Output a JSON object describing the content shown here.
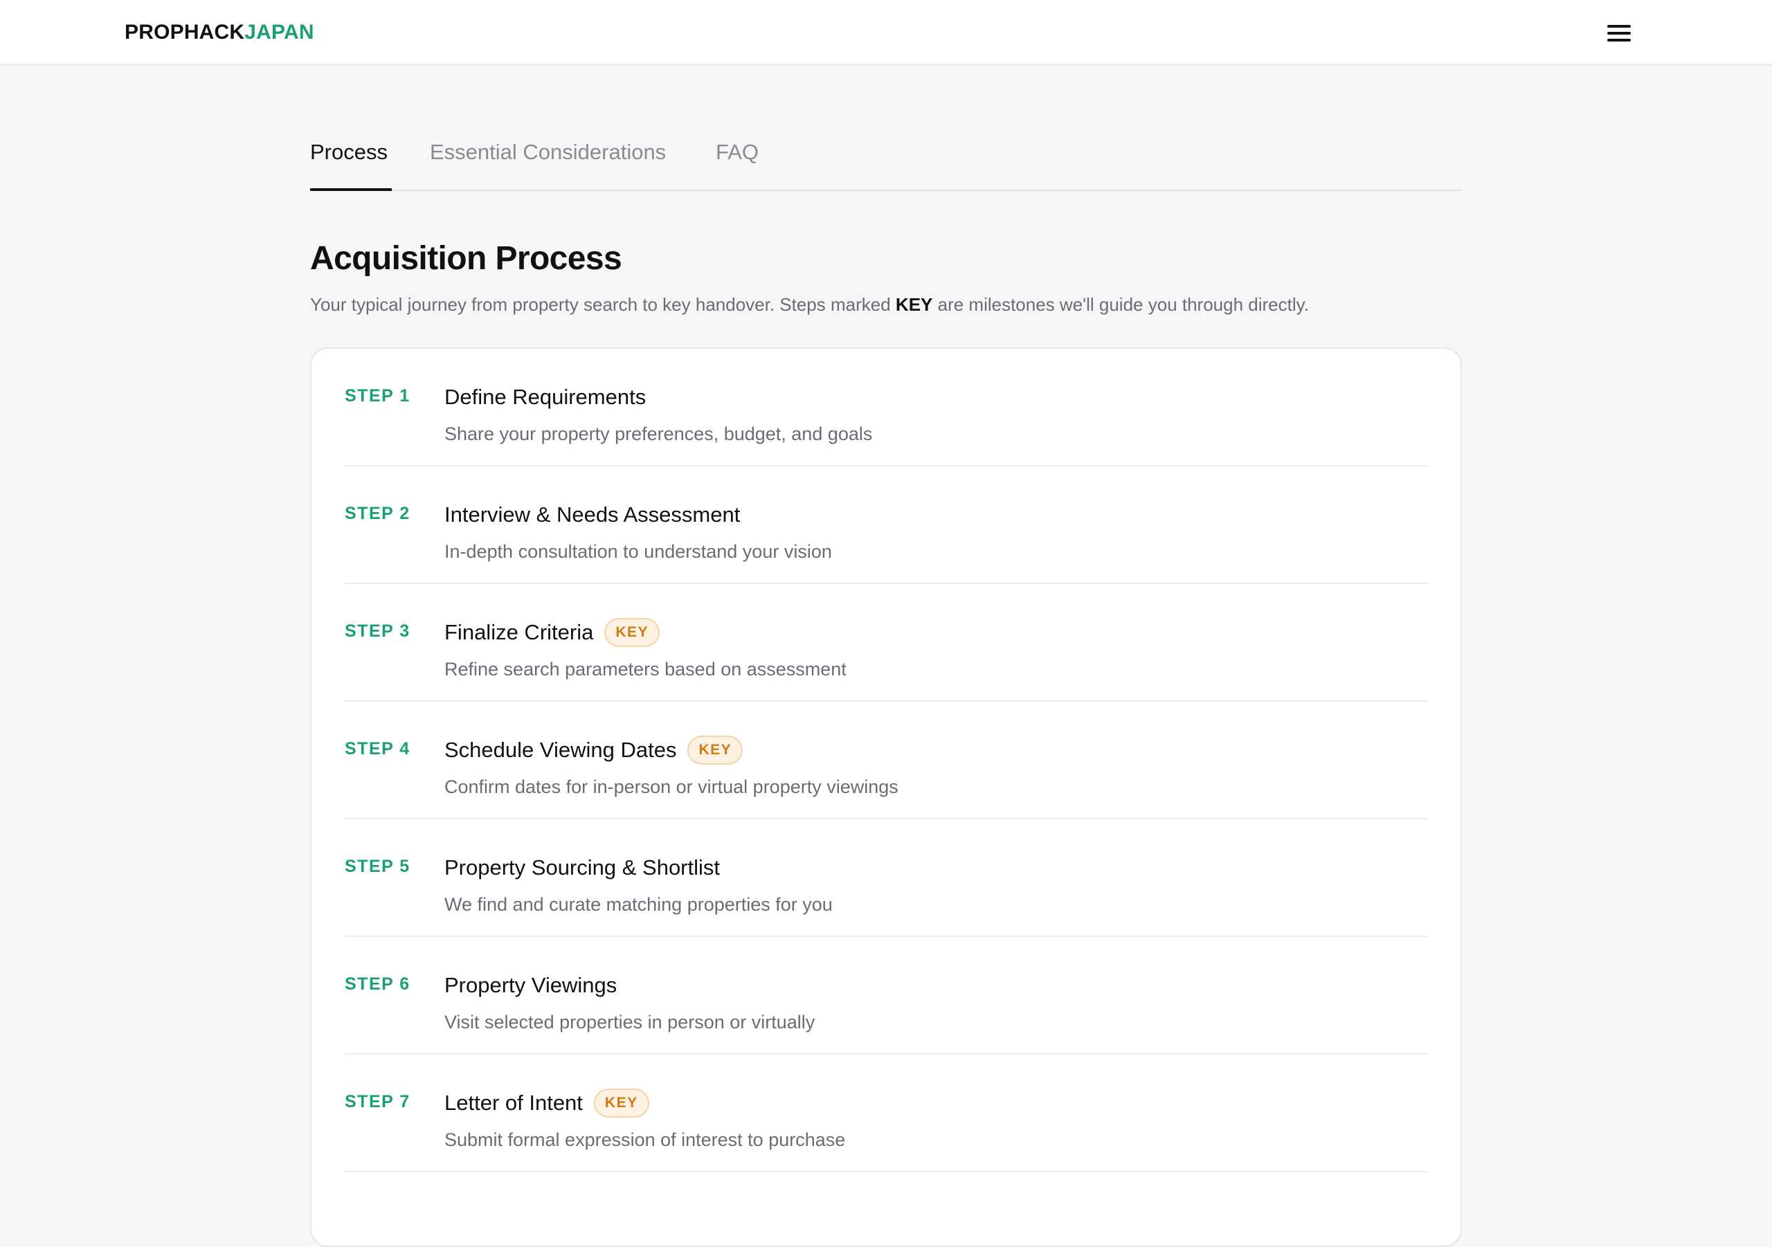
{
  "header": {
    "logo_part1": "PROPHACK",
    "logo_part2": "JAPAN",
    "menu_icon": "hamburger-menu-icon"
  },
  "tabs": [
    {
      "label": "Process",
      "active": true
    },
    {
      "label": "Essential Considerations",
      "active": false
    },
    {
      "label": "FAQ",
      "active": false
    }
  ],
  "main": {
    "title": "Acquisition Process",
    "subtitle_before": "Your typical journey from property search to key handover. Steps marked ",
    "subtitle_key": "KEY",
    "subtitle_after": " are milestones we'll guide you through directly."
  },
  "steps": [
    {
      "label": "STEP 1",
      "title": "Define Requirements",
      "desc": "Share your property preferences, budget, and goals",
      "key": false
    },
    {
      "label": "STEP 2",
      "title": "Interview & Needs Assessment",
      "desc": "In-depth consultation to understand your vision",
      "key": false
    },
    {
      "label": "STEP 3",
      "title": "Finalize Criteria",
      "desc": "Refine search parameters based on assessment",
      "key": true
    },
    {
      "label": "STEP 4",
      "title": "Schedule Viewing Dates",
      "desc": "Confirm dates for in-person or virtual property viewings",
      "key": true
    },
    {
      "label": "STEP 5",
      "title": "Property Sourcing & Shortlist",
      "desc": "We find and curate matching properties for you",
      "key": false
    },
    {
      "label": "STEP 6",
      "title": "Property Viewings",
      "desc": "Visit selected properties in person or virtually",
      "key": false
    },
    {
      "label": "STEP 7",
      "title": "Letter of Intent",
      "desc": "Submit formal expression of interest to purchase",
      "key": true
    }
  ],
  "badge_label": "KEY",
  "colors": {
    "accent_green": "#1a9e76",
    "key_badge_text": "#cf7a12",
    "key_badge_bg": "#fdf1e2",
    "page_bg": "#f6f6f6"
  }
}
